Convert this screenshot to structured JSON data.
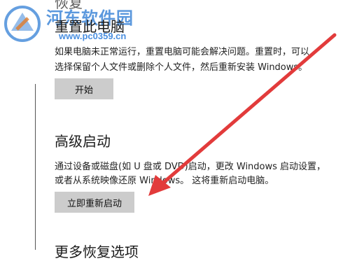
{
  "watermark": {
    "site_name": "河东软件园",
    "url": "www.pc0359.cn"
  },
  "sections": {
    "reset": {
      "clipped_heading": "恢复",
      "title": "重置此电脑",
      "description_line1": "如果电脑未正常运行，重置电脑可能会解决问题。重置时，可以",
      "description_line2": "选择保留个人文件或删除个人文件，然后重新安装 Windows。",
      "button_label": "开始"
    },
    "advanced_startup": {
      "title": "高级启动",
      "description_line1": "通过设备或磁盘(如 U 盘或 DVD)启动，更改 Windows 启动设置，",
      "description_line2": "或者从系统映像还原 Windows。 这将重新启动电脑。",
      "button_label": "立即重新启动"
    },
    "more_recovery": {
      "title": "更多恢复选项"
    }
  },
  "colors": {
    "arrow": "#e23b3b",
    "button_bg": "#cccccc",
    "watermark_blue": "#3f87d8"
  }
}
